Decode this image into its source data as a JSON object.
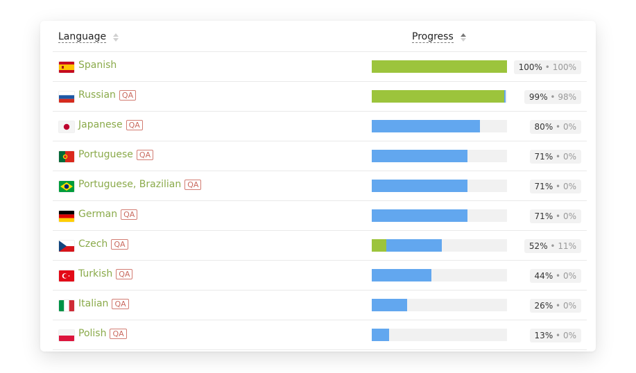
{
  "table": {
    "columns": {
      "language": "Language",
      "progress": "Progress"
    },
    "qa_label": "QA",
    "colors": {
      "translated": "#62a7ef",
      "approved": "#9cc43c",
      "language_name": "#8aaa4a",
      "qa_badge": "#c96a5f"
    },
    "rows": [
      {
        "language": "Spanish",
        "flag": "spain-flag",
        "qa": false,
        "translated": 100,
        "approved": 100,
        "translated_label": "100%",
        "separator": "•",
        "approved_label": "100%"
      },
      {
        "language": "Russian",
        "flag": "russia-flag",
        "qa": true,
        "translated": 99,
        "approved": 98,
        "translated_label": "99%",
        "separator": "•",
        "approved_label": "98%"
      },
      {
        "language": "Japanese",
        "flag": "japan-flag",
        "qa": true,
        "translated": 80,
        "approved": 0,
        "translated_label": "80%",
        "separator": "•",
        "approved_label": "0%"
      },
      {
        "language": "Portuguese",
        "flag": "portugal-flag",
        "qa": true,
        "translated": 71,
        "approved": 0,
        "translated_label": "71%",
        "separator": "•",
        "approved_label": "0%"
      },
      {
        "language": "Portuguese, Brazilian",
        "flag": "brazil-flag",
        "qa": true,
        "translated": 71,
        "approved": 0,
        "translated_label": "71%",
        "separator": "•",
        "approved_label": "0%"
      },
      {
        "language": "German",
        "flag": "germany-flag",
        "qa": true,
        "translated": 71,
        "approved": 0,
        "translated_label": "71%",
        "separator": "•",
        "approved_label": "0%"
      },
      {
        "language": "Czech",
        "flag": "czech-flag",
        "qa": true,
        "translated": 52,
        "approved": 11,
        "translated_label": "52%",
        "separator": "•",
        "approved_label": "11%"
      },
      {
        "language": "Turkish",
        "flag": "turkey-flag",
        "qa": true,
        "translated": 44,
        "approved": 0,
        "translated_label": "44%",
        "separator": "•",
        "approved_label": "0%"
      },
      {
        "language": "Italian",
        "flag": "italy-flag",
        "qa": true,
        "translated": 26,
        "approved": 0,
        "translated_label": "26%",
        "separator": "•",
        "approved_label": "0%"
      },
      {
        "language": "Polish",
        "flag": "poland-flag",
        "qa": true,
        "translated": 13,
        "approved": 0,
        "translated_label": "13%",
        "separator": "•",
        "approved_label": "0%"
      }
    ]
  }
}
